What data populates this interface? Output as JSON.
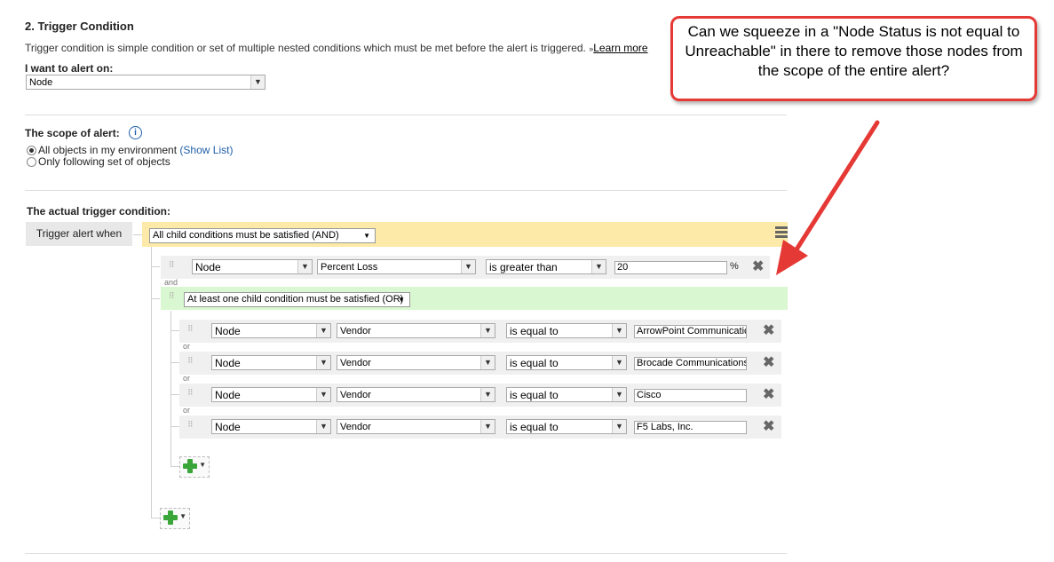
{
  "section": {
    "title": "2. Trigger Condition",
    "description": "Trigger condition is simple condition or set of multiple nested conditions which must be met before the alert is triggered.",
    "learn_more_prefix": "»",
    "learn_more": "Learn more"
  },
  "alert_on": {
    "label": "I want to alert on:",
    "value": "Node"
  },
  "scope": {
    "label": "The scope of alert:",
    "info_icon": "i",
    "option_all": "All objects in my environment",
    "show_list": "(Show List)",
    "option_following": "Only following set of objects",
    "selected": "all"
  },
  "trigger": {
    "label": "The actual trigger condition:",
    "when_label": "Trigger alert when",
    "root_operator": "All child conditions must be satisfied (AND)",
    "condition1": {
      "object": "Node",
      "field": "Percent Loss",
      "operator": "is greater than",
      "value": "20",
      "unit": "%"
    },
    "join_and": "and",
    "group_operator": "At least one child condition must be satisfied (OR)",
    "join_or": "or",
    "or_conditions": [
      {
        "object": "Node",
        "field": "Vendor",
        "operator": "is equal to",
        "value": "ArrowPoint Communicatio"
      },
      {
        "object": "Node",
        "field": "Vendor",
        "operator": "is equal to",
        "value": "Brocade Communications"
      },
      {
        "object": "Node",
        "field": "Vendor",
        "operator": "is equal to",
        "value": "Cisco"
      },
      {
        "object": "Node",
        "field": "Vendor",
        "operator": "is equal to",
        "value": "F5 Labs, Inc."
      }
    ]
  },
  "callout": {
    "text": "Can we squeeze in a \"Node Status is not equal to Unreachable\" in there to remove those nodes from the scope of the entire alert?",
    "color": "#e53935"
  },
  "colors": {
    "and_group": "#fdeaa8",
    "or_group": "#d9f7d0",
    "accent_link": "#1f5fa8",
    "add_green": "#3aa63a"
  }
}
